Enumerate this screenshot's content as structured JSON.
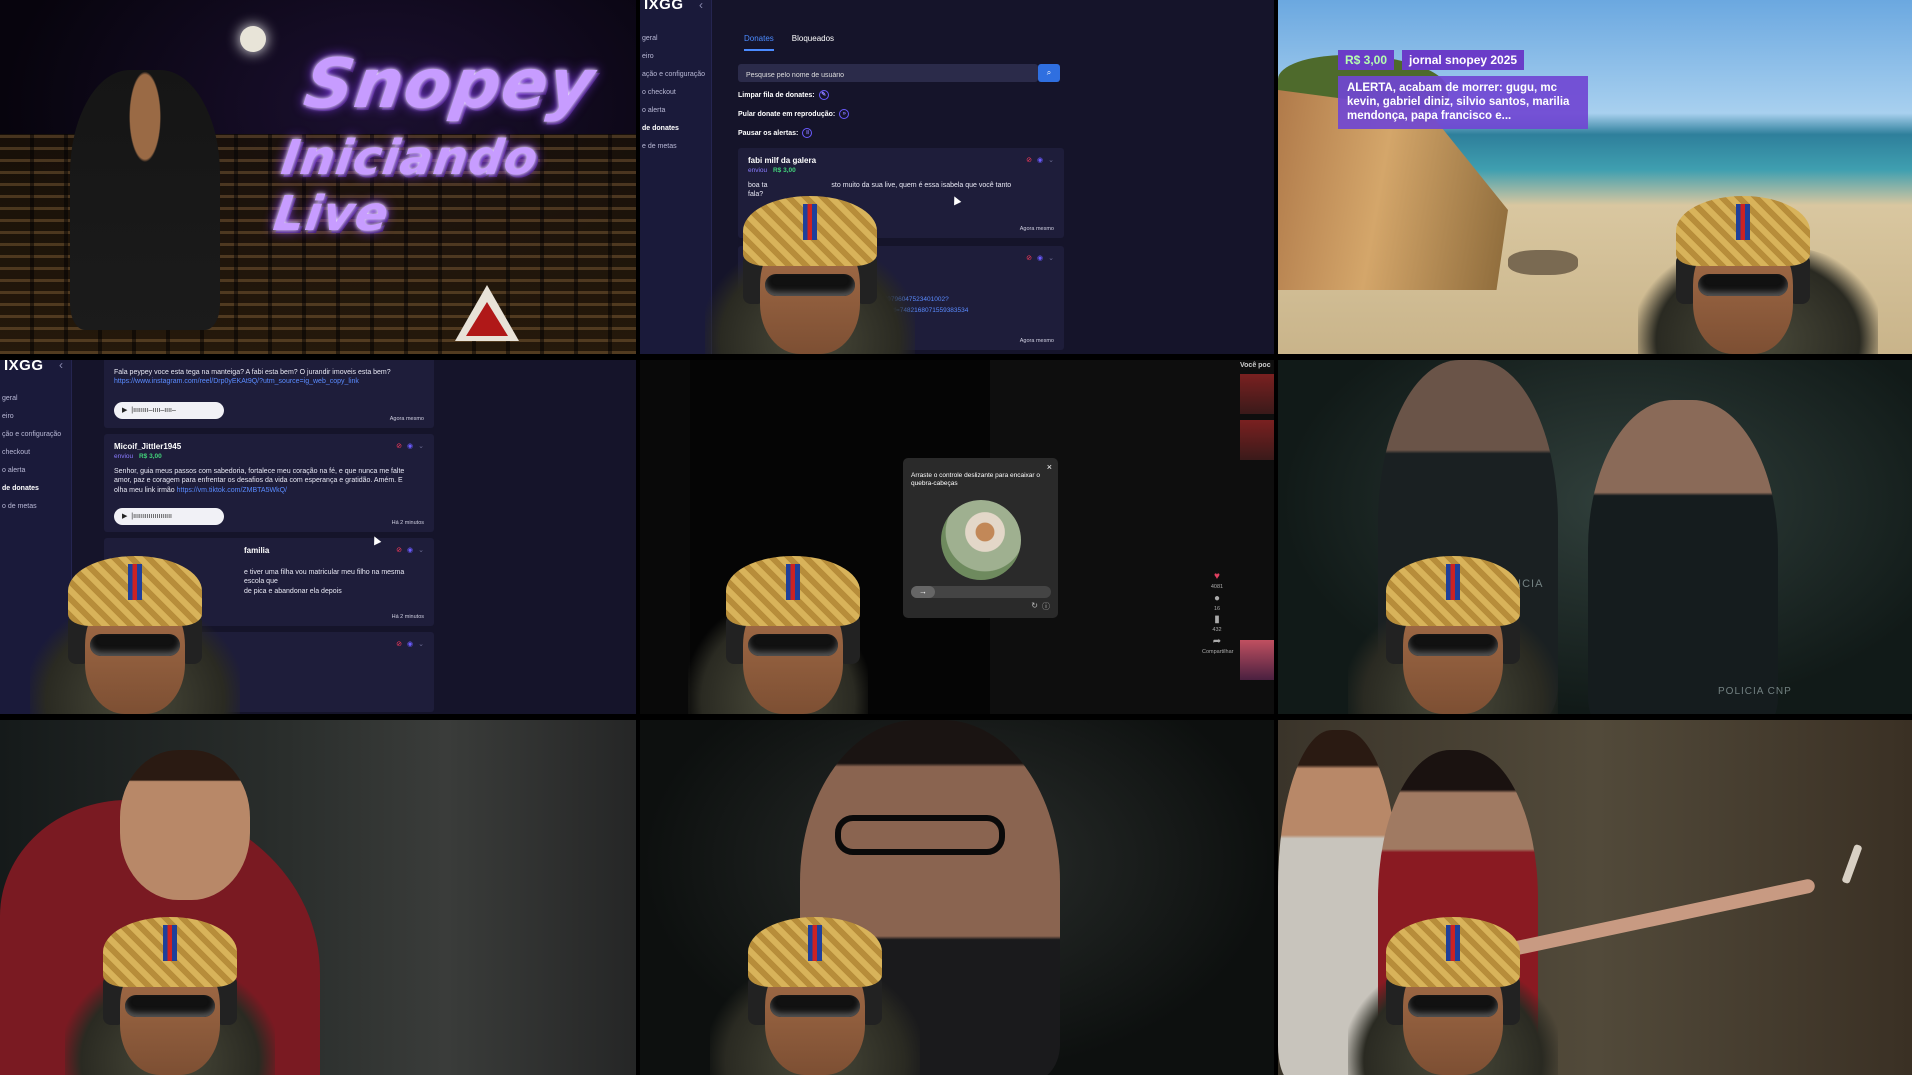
{
  "intro": {
    "title_line1": "Snopey",
    "title_line2": "Iniciando Live"
  },
  "panel": {
    "logo": "IXGG",
    "sidebar_items": [
      "geral",
      "eiro",
      "ação e configuração",
      "o checkout",
      "o alerta",
      "de donates",
      "e de metas"
    ],
    "sidebar_items_b": [
      "geral",
      "eiro",
      "ção e configuração",
      "checkout",
      "o alerta",
      "de donates",
      "o de metas"
    ],
    "tabs": [
      "Donates",
      "Bloqueados"
    ],
    "search_placeholder": "Pesquise pelo nome de usuário",
    "controls": [
      "Limpar fila de donates:",
      "Pular donate em reprodução:",
      "Pausar os alertas:"
    ],
    "donate1": {
      "name": "fabi milf da galera",
      "sent": "enviou",
      "amount": "R$ 3,00",
      "msg_a": "boa ta",
      "msg_b": "sto muito da sua live, quem é essa isabela que você tanto",
      "msg_c": "fala?",
      "time": "Agora mesmo"
    },
    "donate2": {
      "link_a": "47979604752340100​2?",
      "link_b": "eb_id=7482168071559383534",
      "time": "Agora mesmo"
    }
  },
  "panel2": {
    "top_msg": "Fala peypey voce esta tega na manteiga? A fabi esta bem? O jurandir imoveis esta bem?",
    "top_link": "https://www.instagram.com/reel/Drp0yEKAt9Q/?utm_source=ig_web_copy_link",
    "top_time": "Agora mesmo",
    "donate": {
      "name": "Micoif_Jittler1945",
      "sent": "enviou",
      "amount": "R$ 3,00",
      "msg": "Senhor, guia meus passos com sabedoria, fortalece meu coração na fé, e que nunca me falte amor, paz e coragem para enfrentar os desafios da vida com esperança e gratidão. Amém. E olha meu link irmão",
      "link": "https://vm.tiktok.com/ZMBTA5WkQ/",
      "time": "Há 2 minutos"
    },
    "donate3": {
      "name_tail": "familia",
      "msg_a": "e tiver uma filha vou matricular meu filho na mesma escola que",
      "msg_b": "de pica e abandonar ela depois",
      "time": "Há 2 minutos"
    }
  },
  "alert": {
    "amount": "R$ 3,00",
    "name": "jornal snopey 2025",
    "message": "ALERTA, acabam de morrer: gugu, mc kevin, gabriel diniz, silvio santos, marilia mendonça, papa francisco e..."
  },
  "tiktok": {
    "captcha_text": "Arraste o controle deslizante para encaixar o quebra-cabeças",
    "side_counts": [
      "4081",
      "16",
      "432",
      "Compartilhar"
    ],
    "related_header": "Você poc"
  },
  "scene": {
    "police_label_1": "POLICIA",
    "police_label_2": "POLICIA CNP"
  }
}
